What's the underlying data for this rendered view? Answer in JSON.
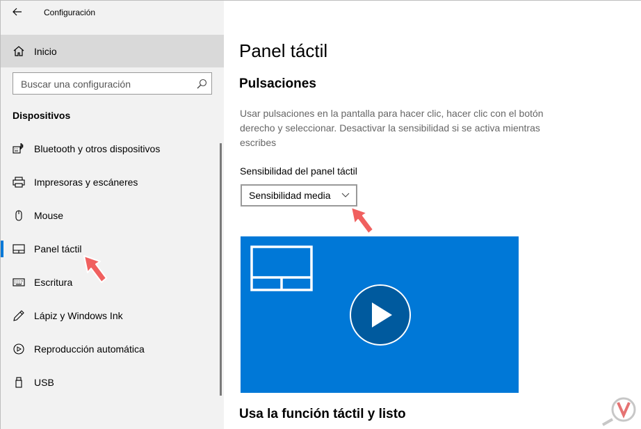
{
  "window": {
    "title": "Configuración",
    "controls": [
      "minimize",
      "maximize",
      "close"
    ]
  },
  "sidebar": {
    "home_label": "Inicio",
    "search_placeholder": "Buscar una configuración",
    "section_title": "Dispositivos",
    "items": [
      {
        "label": "Bluetooth y otros dispositivos",
        "icon": "keyboard-bluetooth-icon",
        "selected": false
      },
      {
        "label": "Impresoras y escáneres",
        "icon": "printer-icon",
        "selected": false
      },
      {
        "label": "Mouse",
        "icon": "mouse-icon",
        "selected": false
      },
      {
        "label": "Panel táctil",
        "icon": "touchpad-icon",
        "selected": true
      },
      {
        "label": "Escritura",
        "icon": "keyboard-icon",
        "selected": false
      },
      {
        "label": "Lápiz y Windows Ink",
        "icon": "pen-icon",
        "selected": false
      },
      {
        "label": "Reproducción automática",
        "icon": "autoplay-icon",
        "selected": false
      },
      {
        "label": "USB",
        "icon": "usb-icon",
        "selected": false
      }
    ]
  },
  "main": {
    "page_title": "Panel táctil",
    "section_title": "Pulsaciones",
    "description": "Usar pulsaciones en la pantalla para hacer clic, hacer clic con el botón derecho y seleccionar. Desactivar la sensibilidad si se activa mientras escribes",
    "sensitivity_label": "Sensibilidad del panel táctil",
    "sensitivity_value": "Sensibilidad media",
    "bottom_title": "Usa la función táctil y listo"
  },
  "colors": {
    "accent": "#0078d7",
    "sidebar_bg": "#f2f2f2",
    "selected_home_bg": "#d9d9d9",
    "annotation_arrow": "#f0605f"
  }
}
